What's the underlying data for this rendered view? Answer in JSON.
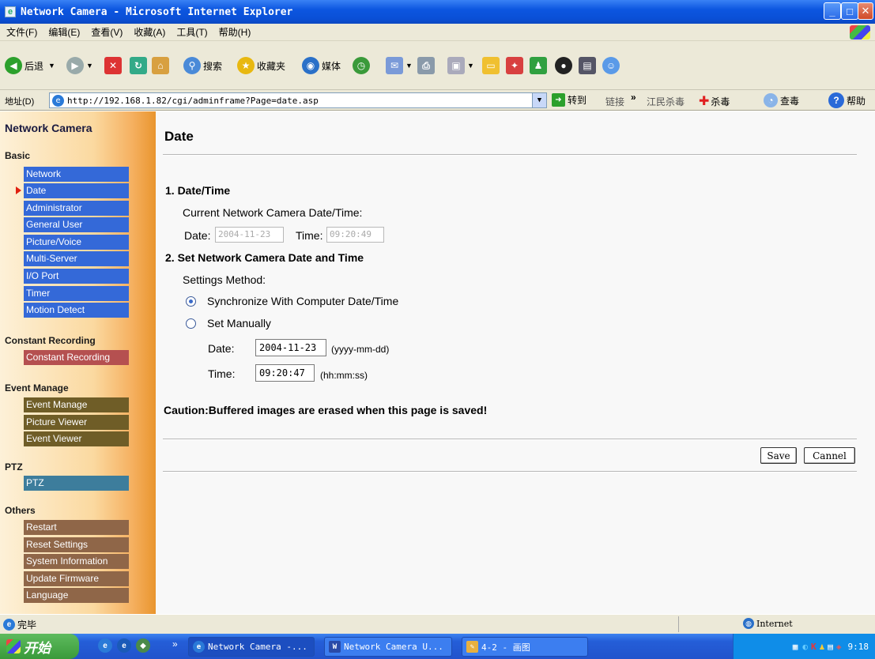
{
  "window": {
    "title": "Network Camera - Microsoft Internet Explorer"
  },
  "menu": [
    "文件(F)",
    "编辑(E)",
    "查看(V)",
    "收藏(A)",
    "工具(T)",
    "帮助(H)"
  ],
  "toolbar": {
    "back": "后退",
    "search": "搜索",
    "favorites": "收藏夹",
    "media": "媒体"
  },
  "address": {
    "label": "地址(D)",
    "url": "http://192.168.1.82/cgi/adminframe?Page=date.asp",
    "go": "转到",
    "links": "链接",
    "extra1": "江民杀毒",
    "extra2": "杀毒",
    "extra3": "查毒",
    "help": "帮助"
  },
  "sidebar": {
    "title": "Network Camera",
    "basic_head": "Basic",
    "basic": [
      "Network",
      "Date",
      "Administrator",
      "General User",
      "Picture/Voice",
      "Multi-Server",
      "I/O Port",
      "Timer",
      "Motion Detect"
    ],
    "constant_head": "Constant Recording",
    "constant": [
      "Constant Recording"
    ],
    "event_head": "Event Manage",
    "event": [
      "Event Manage",
      "Picture Viewer",
      "Event Viewer"
    ],
    "ptz_head": "PTZ",
    "ptz": [
      "PTZ"
    ],
    "others_head": "Others",
    "others": [
      "Restart",
      "Reset Settings",
      "System Information",
      "Update Firmware",
      "Language"
    ]
  },
  "main": {
    "title": "Date",
    "sec1": "1. Date/Time",
    "current_label": "Current Network Camera Date/Time:",
    "date_label": "Date:",
    "current_date": "2004-11-23",
    "time_label": "Time:",
    "current_time": "09:20:49",
    "sec2": "2. Set Network Camera Date and Time",
    "method_label": "Settings Method:",
    "opt_sync": "Synchronize With Computer Date/Time",
    "opt_manual": "Set Manually",
    "set_date_label": "Date:",
    "set_date": "2004-11-23",
    "date_fmt": "(yyyy-mm-dd)",
    "set_time_label": "Time:",
    "set_time": "09:20:47",
    "time_fmt": "(hh:mm:ss)",
    "caution": "Caution:Buffered images are erased when this page is saved!",
    "save": "Save",
    "cancel": "Cannel"
  },
  "status": {
    "done": "完毕",
    "zone": "Internet"
  },
  "taskbar": {
    "start": "开始",
    "tasks": [
      "Network Camera -...",
      "Network Camera U...",
      "4-2 - 画图"
    ],
    "clock": "9:18"
  }
}
